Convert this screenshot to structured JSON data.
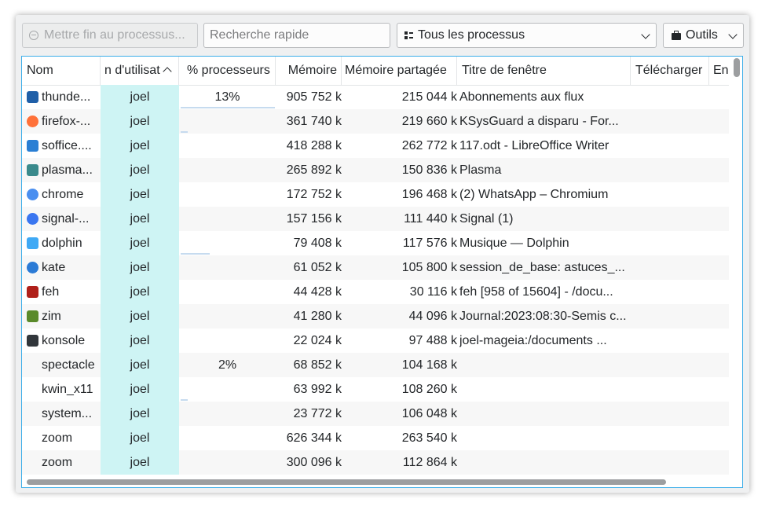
{
  "toolbar": {
    "end_process_label": "Mettre fin au processus...",
    "search_placeholder": "Recherche rapide",
    "filter_selected": "Tous les processus",
    "tools_label": "Outils"
  },
  "table": {
    "headers": {
      "name": "Nom",
      "user": "n d'utilisat",
      "cpu": "% processeurs",
      "memory": "Mémoire",
      "shared": "Mémoire partagée",
      "title": "Titre de fenêtre",
      "download": "Télécharger",
      "extra": "En"
    },
    "sort_column": "user",
    "rows": [
      {
        "name": "thunde...",
        "icon": "thunderbird-icon",
        "color": "#1f5fa8",
        "user": "joel",
        "cpu": "13%",
        "cpu_load": 0.13,
        "memory": "905 752 k",
        "shared": "215 044 k",
        "title": "Abonnements aux flux"
      },
      {
        "name": "firefox-...",
        "icon": "firefox-icon",
        "color": "#ff7139",
        "user": "joel",
        "cpu": "",
        "cpu_load": 0.01,
        "memory": "361 740 k",
        "shared": "219 660 k",
        "title": "KSysGuard a disparu - For..."
      },
      {
        "name": "soffice....",
        "icon": "libreoffice-writer-icon",
        "color": "#2a7fd4",
        "user": "joel",
        "cpu": "",
        "cpu_load": 0,
        "memory": "418 288 k",
        "shared": "262 772 k",
        "title": "117.odt - LibreOffice Writer"
      },
      {
        "name": "plasma...",
        "icon": "plasma-icon",
        "color": "#3a8a8c",
        "user": "joel",
        "cpu": "",
        "cpu_load": 0,
        "memory": "265 892 k",
        "shared": "150 836 k",
        "title": "Plasma"
      },
      {
        "name": "chrome",
        "icon": "chromium-icon",
        "color": "#4a8ff0",
        "user": "joel",
        "cpu": "",
        "cpu_load": 0,
        "memory": "172 752 k",
        "shared": "196 468 k",
        "title": "(2) WhatsApp – Chromium"
      },
      {
        "name": "signal-...",
        "icon": "signal-icon",
        "color": "#3a76f0",
        "user": "joel",
        "cpu": "",
        "cpu_load": 0,
        "memory": "157 156 k",
        "shared": "111 440 k",
        "title": "Signal (1)"
      },
      {
        "name": "dolphin",
        "icon": "dolphin-folder-icon",
        "color": "#3fa9f5",
        "user": "joel",
        "cpu": "",
        "cpu_load": 0.04,
        "memory": "79 408 k",
        "shared": "117 576 k",
        "title": "Musique — Dolphin"
      },
      {
        "name": "kate",
        "icon": "kate-icon",
        "color": "#2b7bd6",
        "user": "joel",
        "cpu": "",
        "cpu_load": 0,
        "memory": "61 052 k",
        "shared": "105 800 k",
        "title": "session_de_base: astuces_..."
      },
      {
        "name": "feh",
        "icon": "feh-icon",
        "color": "#b0201a",
        "user": "joel",
        "cpu": "",
        "cpu_load": 0,
        "memory": "44 428 k",
        "shared": "30 116 k",
        "title": "feh [958 of 15604] - /docu..."
      },
      {
        "name": "zim",
        "icon": "zim-icon",
        "color": "#5a8a2a",
        "user": "joel",
        "cpu": "",
        "cpu_load": 0,
        "memory": "41 280 k",
        "shared": "44 096 k",
        "title": "Journal:2023:08:30-Semis c..."
      },
      {
        "name": "konsole",
        "icon": "konsole-icon",
        "color": "#31363b",
        "user": "joel",
        "cpu": "",
        "cpu_load": 0,
        "memory": "22 024 k",
        "shared": "97 488 k",
        "title": "joel-mageia:/documents ..."
      },
      {
        "name": "spectacle",
        "icon": "",
        "color": "",
        "user": "joel",
        "cpu": "2%",
        "cpu_load": 0,
        "memory": "68 852 k",
        "shared": "104 168 k",
        "title": ""
      },
      {
        "name": "kwin_x11",
        "icon": "",
        "color": "",
        "user": "joel",
        "cpu": "",
        "cpu_load": 0.01,
        "memory": "63 992 k",
        "shared": "108 260 k",
        "title": ""
      },
      {
        "name": "system...",
        "icon": "",
        "color": "",
        "user": "joel",
        "cpu": "",
        "cpu_load": 0,
        "memory": "23 772 k",
        "shared": "106 048 k",
        "title": ""
      },
      {
        "name": "zoom",
        "icon": "",
        "color": "",
        "user": "joel",
        "cpu": "",
        "cpu_load": 0,
        "memory": "626 344 k",
        "shared": "263 540 k",
        "title": ""
      },
      {
        "name": "zoom",
        "icon": "",
        "color": "",
        "user": "joel",
        "cpu": "",
        "cpu_load": 0,
        "memory": "300 096 k",
        "shared": "112 864 k",
        "title": ""
      }
    ]
  },
  "colors": {
    "accent": "#3daee9",
    "user_column": "#cef4f4",
    "cpu_bar": "#c6dbef"
  }
}
